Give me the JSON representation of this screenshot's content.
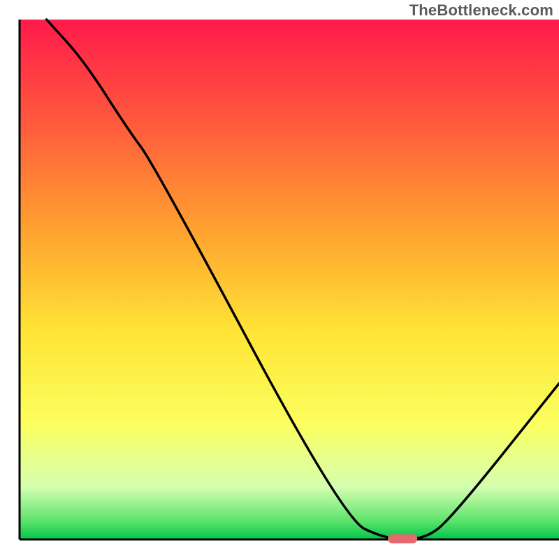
{
  "watermark": "TheBottleneck.com",
  "chart_data": {
    "type": "line",
    "title": "",
    "xlabel": "",
    "ylabel": "",
    "xlim": [
      0,
      100
    ],
    "ylim": [
      0,
      100
    ],
    "grid": false,
    "legend": false,
    "annotations": [],
    "background": {
      "type": "vertical-gradient",
      "stops": [
        {
          "pos": 0.0,
          "color": "#ff1a4b"
        },
        {
          "pos": 0.2,
          "color": "#ff5a3c"
        },
        {
          "pos": 0.4,
          "color": "#ffa030"
        },
        {
          "pos": 0.6,
          "color": "#ffe435"
        },
        {
          "pos": 0.78,
          "color": "#fbff60"
        },
        {
          "pos": 0.9,
          "color": "#d4ffb0"
        },
        {
          "pos": 0.965,
          "color": "#5be36b"
        },
        {
          "pos": 1.0,
          "color": "#00c64b"
        }
      ]
    },
    "series": [
      {
        "name": "bottleneck-curve",
        "color": "#000000",
        "x": [
          5,
          12,
          20,
          25,
          60,
          68,
          75,
          80,
          100
        ],
        "y": [
          100,
          92,
          79,
          72,
          4,
          0,
          0,
          4,
          30
        ]
      }
    ],
    "marker": {
      "name": "optimal-point",
      "x": 71,
      "y": 0,
      "color": "#e46a6f",
      "shape": "pill"
    }
  }
}
